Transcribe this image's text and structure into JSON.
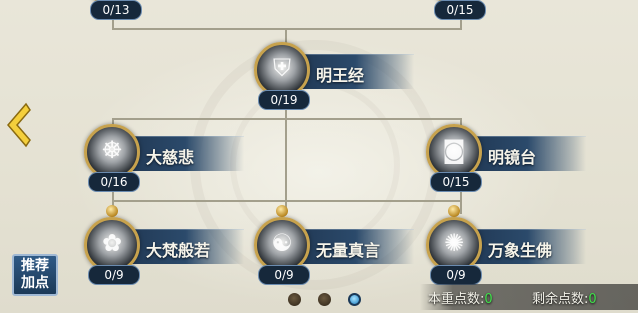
{
  "skills": {
    "top_left": {
      "name": "",
      "count": "0/13"
    },
    "top_right": {
      "name": "",
      "count": "0/15"
    },
    "mingwangjing": {
      "name": "明王经",
      "count": "0/19"
    },
    "dacibei": {
      "name": "大慈悲",
      "count": "0/16"
    },
    "mingjingtai": {
      "name": "明镜台",
      "count": "0/15"
    },
    "dafanbore": {
      "name": "大梵般若",
      "count": "0/9"
    },
    "wuliangzhenyan": {
      "name": "无量真言",
      "count": "0/9"
    },
    "wanxiangshengfo": {
      "name": "万象生佛",
      "count": "0/9"
    }
  },
  "recommend_button": {
    "line1": "推荐",
    "line2": "加点"
  },
  "footer": {
    "reset_label": "本重点数:",
    "reset_value": "0",
    "remain_label": "剩余点数:",
    "remain_value": "0"
  },
  "pagination": {
    "total": 3,
    "active": 3
  },
  "colors": {
    "accent_gold": "#c7a24d",
    "banner_blue": "#1f3550",
    "value_green": "#3fe04a"
  },
  "icons": {
    "back": "chevron-left-icon"
  }
}
